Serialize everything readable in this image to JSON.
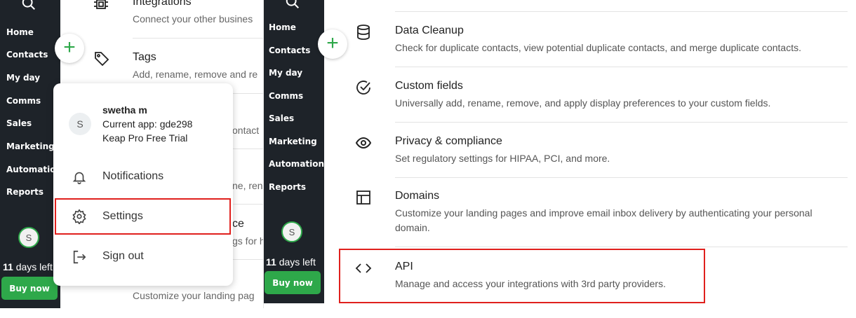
{
  "left_nav": {
    "items": [
      "Home",
      "Contacts",
      "My day",
      "Comms",
      "Sales",
      "Marketing",
      "Automation",
      "Reports"
    ],
    "avatar_initial": "S",
    "days_bold": "11",
    "days_rest": "days left",
    "buy_label": "Buy now"
  },
  "mid_panel": {
    "rows": [
      {
        "title": "Integrations",
        "desc": "Connect your other busines"
      },
      {
        "title": "Tags",
        "desc": "Add, rename, remove and re"
      },
      {
        "title": "",
        "desc": "ontact"
      },
      {
        "title": "",
        "desc": "ne, ren"
      },
      {
        "title": "ce",
        "desc": "gs for h"
      },
      {
        "title": "",
        "desc": "Customize your landing pag"
      }
    ]
  },
  "account_menu": {
    "avatar_initial": "S",
    "user_name": "swetha m",
    "current_app": "Current app: gde298",
    "plan": "Keap Pro Free Trial",
    "notifications_label": "Notifications",
    "settings_label": "Settings",
    "signout_label": "Sign out"
  },
  "settings_list": [
    {
      "title": "Data Cleanup",
      "desc": "Check for duplicate contacts, view potential duplicate contacts, and merge duplicate contacts.",
      "icon": "database-icon"
    },
    {
      "title": "Custom fields",
      "desc": "Universally add, rename, remove, and apply display preferences to your custom fields.",
      "icon": "check-circle-icon"
    },
    {
      "title": "Privacy & compliance",
      "desc": "Set regulatory settings for HIPAA, PCI, and more.",
      "icon": "eye-icon"
    },
    {
      "title": "Domains",
      "desc": "Customize your landing pages and improve email inbox delivery by authenticating your personal domain.",
      "icon": "layout-icon"
    },
    {
      "title": "API",
      "desc": "Manage and access your integrations with 3rd party providers.",
      "icon": "code-icon"
    }
  ],
  "colors": {
    "sidebar": "#1e2329",
    "accent_green": "#2ea84a",
    "highlight_red": "#e0201d"
  }
}
